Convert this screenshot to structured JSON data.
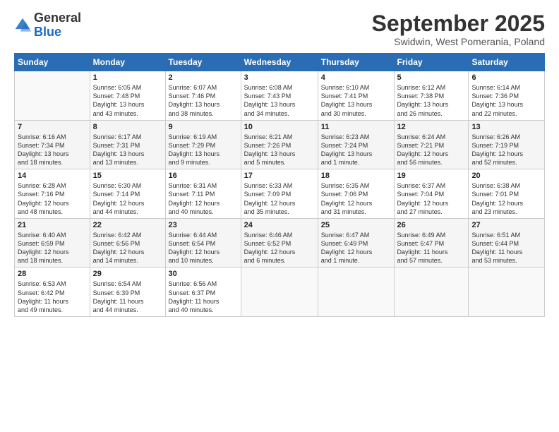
{
  "header": {
    "logo_general": "General",
    "logo_blue": "Blue",
    "month_title": "September 2025",
    "subtitle": "Swidwin, West Pomerania, Poland"
  },
  "weekdays": [
    "Sunday",
    "Monday",
    "Tuesday",
    "Wednesday",
    "Thursday",
    "Friday",
    "Saturday"
  ],
  "weeks": [
    [
      {
        "day": "",
        "info": ""
      },
      {
        "day": "1",
        "info": "Sunrise: 6:05 AM\nSunset: 7:48 PM\nDaylight: 13 hours\nand 43 minutes."
      },
      {
        "day": "2",
        "info": "Sunrise: 6:07 AM\nSunset: 7:46 PM\nDaylight: 13 hours\nand 38 minutes."
      },
      {
        "day": "3",
        "info": "Sunrise: 6:08 AM\nSunset: 7:43 PM\nDaylight: 13 hours\nand 34 minutes."
      },
      {
        "day": "4",
        "info": "Sunrise: 6:10 AM\nSunset: 7:41 PM\nDaylight: 13 hours\nand 30 minutes."
      },
      {
        "day": "5",
        "info": "Sunrise: 6:12 AM\nSunset: 7:38 PM\nDaylight: 13 hours\nand 26 minutes."
      },
      {
        "day": "6",
        "info": "Sunrise: 6:14 AM\nSunset: 7:36 PM\nDaylight: 13 hours\nand 22 minutes."
      }
    ],
    [
      {
        "day": "7",
        "info": "Sunrise: 6:16 AM\nSunset: 7:34 PM\nDaylight: 13 hours\nand 18 minutes."
      },
      {
        "day": "8",
        "info": "Sunrise: 6:17 AM\nSunset: 7:31 PM\nDaylight: 13 hours\nand 13 minutes."
      },
      {
        "day": "9",
        "info": "Sunrise: 6:19 AM\nSunset: 7:29 PM\nDaylight: 13 hours\nand 9 minutes."
      },
      {
        "day": "10",
        "info": "Sunrise: 6:21 AM\nSunset: 7:26 PM\nDaylight: 13 hours\nand 5 minutes."
      },
      {
        "day": "11",
        "info": "Sunrise: 6:23 AM\nSunset: 7:24 PM\nDaylight: 13 hours\nand 1 minute."
      },
      {
        "day": "12",
        "info": "Sunrise: 6:24 AM\nSunset: 7:21 PM\nDaylight: 12 hours\nand 56 minutes."
      },
      {
        "day": "13",
        "info": "Sunrise: 6:26 AM\nSunset: 7:19 PM\nDaylight: 12 hours\nand 52 minutes."
      }
    ],
    [
      {
        "day": "14",
        "info": "Sunrise: 6:28 AM\nSunset: 7:16 PM\nDaylight: 12 hours\nand 48 minutes."
      },
      {
        "day": "15",
        "info": "Sunrise: 6:30 AM\nSunset: 7:14 PM\nDaylight: 12 hours\nand 44 minutes."
      },
      {
        "day": "16",
        "info": "Sunrise: 6:31 AM\nSunset: 7:11 PM\nDaylight: 12 hours\nand 40 minutes."
      },
      {
        "day": "17",
        "info": "Sunrise: 6:33 AM\nSunset: 7:09 PM\nDaylight: 12 hours\nand 35 minutes."
      },
      {
        "day": "18",
        "info": "Sunrise: 6:35 AM\nSunset: 7:06 PM\nDaylight: 12 hours\nand 31 minutes."
      },
      {
        "day": "19",
        "info": "Sunrise: 6:37 AM\nSunset: 7:04 PM\nDaylight: 12 hours\nand 27 minutes."
      },
      {
        "day": "20",
        "info": "Sunrise: 6:38 AM\nSunset: 7:01 PM\nDaylight: 12 hours\nand 23 minutes."
      }
    ],
    [
      {
        "day": "21",
        "info": "Sunrise: 6:40 AM\nSunset: 6:59 PM\nDaylight: 12 hours\nand 18 minutes."
      },
      {
        "day": "22",
        "info": "Sunrise: 6:42 AM\nSunset: 6:56 PM\nDaylight: 12 hours\nand 14 minutes."
      },
      {
        "day": "23",
        "info": "Sunrise: 6:44 AM\nSunset: 6:54 PM\nDaylight: 12 hours\nand 10 minutes."
      },
      {
        "day": "24",
        "info": "Sunrise: 6:46 AM\nSunset: 6:52 PM\nDaylight: 12 hours\nand 6 minutes."
      },
      {
        "day": "25",
        "info": "Sunrise: 6:47 AM\nSunset: 6:49 PM\nDaylight: 12 hours\nand 1 minute."
      },
      {
        "day": "26",
        "info": "Sunrise: 6:49 AM\nSunset: 6:47 PM\nDaylight: 11 hours\nand 57 minutes."
      },
      {
        "day": "27",
        "info": "Sunrise: 6:51 AM\nSunset: 6:44 PM\nDaylight: 11 hours\nand 53 minutes."
      }
    ],
    [
      {
        "day": "28",
        "info": "Sunrise: 6:53 AM\nSunset: 6:42 PM\nDaylight: 11 hours\nand 49 minutes."
      },
      {
        "day": "29",
        "info": "Sunrise: 6:54 AM\nSunset: 6:39 PM\nDaylight: 11 hours\nand 44 minutes."
      },
      {
        "day": "30",
        "info": "Sunrise: 6:56 AM\nSunset: 6:37 PM\nDaylight: 11 hours\nand 40 minutes."
      },
      {
        "day": "",
        "info": ""
      },
      {
        "day": "",
        "info": ""
      },
      {
        "day": "",
        "info": ""
      },
      {
        "day": "",
        "info": ""
      }
    ]
  ]
}
